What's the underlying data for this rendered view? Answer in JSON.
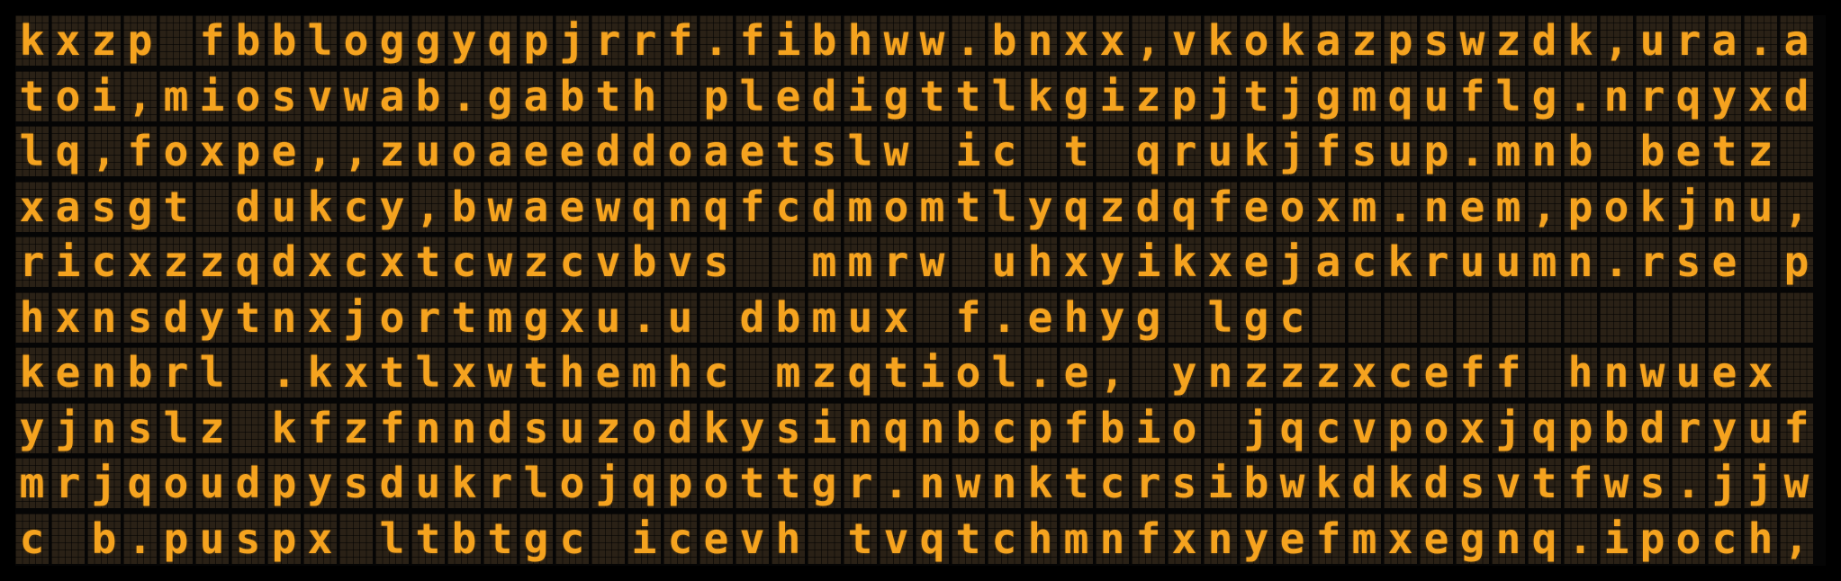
{
  "display": {
    "text_color": "#f5a31f",
    "cell_color": "#2a2116",
    "background_color": "#000000",
    "lines": [
      "kxzp fbbloggyqpjrrf.fibhww.bnxx,vkokazpswzdk,ura.a",
      "toi,miosvwab.gabth pledigttlkgizpjtjgmquflg.nrqyxd",
      "lq,foxpe,,zuoaeeddoaetslw ic t qrukjfsup.mnb betz",
      "xasgt dukcy,bwaewqnqfcdmomtlyqzdqfeoxm.nem,pokjnu,",
      "ricxzzqdxcxtcwzcvbvs  mmrw uhxyikxejackruumn.rse p",
      "hxnsdytnxjortmgxu.u dbmux f.ehyg lgc",
      "kenbrl .kxtlxwthemhc mzqtiol.e, ynzzzxceff hnwuex",
      "yjnslz kfzfnndsuzodkysinqnbcpfbio jqcvpoxjqpbdryuf",
      "mrjqoudpysdukrlojqpottgr.nwnktcrsibwkdkdsvtfws.jjw",
      "c b.puspx ltbtgc icevh tvqtchmnfxnyefmxegnq.ipoch,"
    ]
  }
}
